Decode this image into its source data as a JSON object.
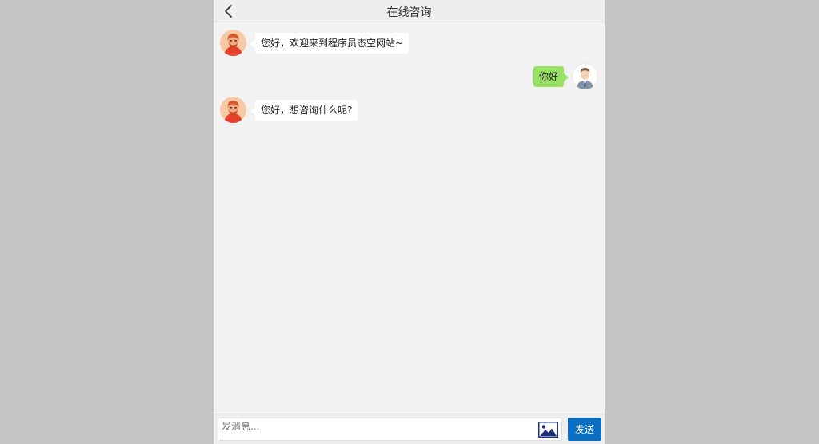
{
  "header": {
    "title": "在线咨询",
    "back_icon": "chevron-left-icon"
  },
  "messages": [
    {
      "side": "left",
      "avatar": "agent-avatar",
      "text": "您好，欢迎来到程序员态空网站~"
    },
    {
      "side": "right",
      "avatar": "user-avatar",
      "text": "你好"
    },
    {
      "side": "left",
      "avatar": "agent-avatar",
      "text": "您好，想咨询什么呢?"
    }
  ],
  "composer": {
    "placeholder": "发消息...",
    "value": "",
    "image_icon": "image-icon",
    "send_label": "发送"
  },
  "colors": {
    "page_background": "#c4c4c4",
    "chat_background": "#f2f2f2",
    "user_bubble": "#98e165",
    "agent_bubble": "#ffffff",
    "send_button": "#0a6fc2"
  }
}
